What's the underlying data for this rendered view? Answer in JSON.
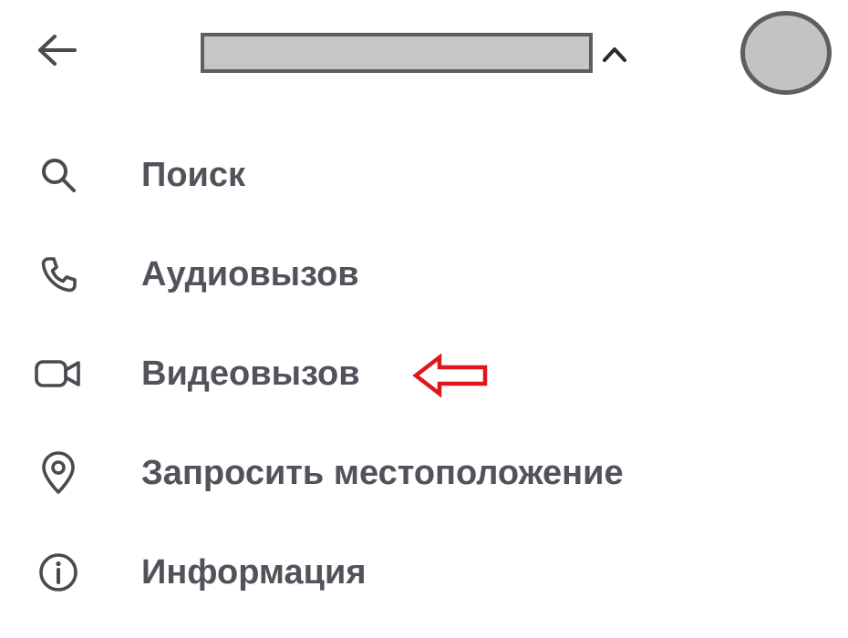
{
  "header": {
    "back_icon": "arrow-left-icon",
    "title_redacted": true,
    "expand_icon": "chevron-up-icon",
    "avatar_color": "#c3c3c3"
  },
  "menu": {
    "items": [
      {
        "label": "Поиск",
        "icon": "search-icon"
      },
      {
        "label": "Аудиовызов",
        "icon": "phone-icon"
      },
      {
        "label": "Видеовызов",
        "icon": "video-camera-icon"
      },
      {
        "label": "Запросить местоположение",
        "icon": "location-pin-icon"
      },
      {
        "label": "Информация",
        "icon": "info-icon"
      }
    ]
  },
  "annotation": {
    "icon": "red-arrow-left-icon",
    "color": "#e0161c",
    "points_to": "Видеовызов"
  },
  "colors": {
    "text": "#52525b",
    "icon": "#4a4a50",
    "background": "#ffffff"
  }
}
